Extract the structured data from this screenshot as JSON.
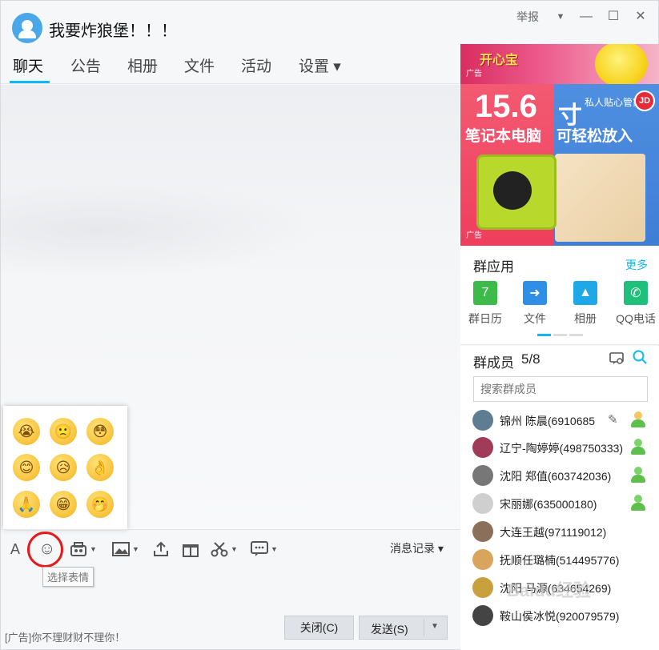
{
  "window": {
    "title": "我要炸狼堡！！！",
    "report_label": "举报",
    "dropdown_glyph": "▼",
    "minimize_glyph": "—",
    "maximize_glyph": "☐",
    "close_glyph": "✕"
  },
  "tabs": [
    {
      "label": "聊天",
      "active": true
    },
    {
      "label": "公告"
    },
    {
      "label": "相册"
    },
    {
      "label": "文件"
    },
    {
      "label": "活动"
    },
    {
      "label": "设置 ▾"
    }
  ],
  "emoji_panel": {
    "faces": [
      "😭",
      "🙁",
      "😳",
      "😊",
      "😥",
      "👌",
      "🙏",
      "😁",
      "🤭"
    ]
  },
  "toolbar": {
    "font_glyph": "A",
    "emoji_glyph": "☺",
    "tooltip": "选择表情",
    "history_label": "消息记录 ▾"
  },
  "footer": {
    "ad_text": "[广告]你不理财财不理你！",
    "close_label": "关闭(C)",
    "send_label": "发送(S)"
  },
  "ads": {
    "tag": "广告",
    "top_badge": "开心宝",
    "big_number": "15.6",
    "left_sub": "笔记本电脑",
    "cun": "寸",
    "cun_note": "私人贴心管家",
    "right_sub": "可轻松放入",
    "jd": "JD"
  },
  "apps": {
    "title": "群应用",
    "more": "更多",
    "items": [
      {
        "label": "群日历",
        "icon": "calendar-icon",
        "color": "#3dbb4a",
        "glyph": "7"
      },
      {
        "label": "文件",
        "icon": "folder-icon",
        "color": "#2f8ee6",
        "glyph": "➜"
      },
      {
        "label": "相册",
        "icon": "album-icon",
        "color": "#1fa8e8",
        "glyph": "▲"
      },
      {
        "label": "QQ电话",
        "icon": "phone-icon",
        "color": "#21c07a",
        "glyph": "✆"
      }
    ]
  },
  "members": {
    "title": "群成员",
    "count": "5/8",
    "search_placeholder": "搜索群成员",
    "list": [
      {
        "name": "锦州 陈晨(6910685",
        "avatar": "#5f7d92",
        "role": "owner",
        "edit": true
      },
      {
        "name": "辽宁-陶婷婷(498750333)",
        "avatar": "#a13b5a",
        "role": "member"
      },
      {
        "name": "沈阳 郑值(603742036)",
        "avatar": "#777777",
        "role": "member"
      },
      {
        "name": "宋丽娜(635000180)",
        "avatar": "#cfcfcf",
        "role": "member"
      },
      {
        "name": "大连王越(971119012)",
        "avatar": "#8a6f5b",
        "role": "none"
      },
      {
        "name": "抚顺任璐楠(514495776)",
        "avatar": "#d9a45c",
        "role": "none"
      },
      {
        "name": "沈阳 马源(634654269)",
        "avatar": "#c9a03e",
        "role": "none"
      },
      {
        "name": "鞍山侯冰悦(920079579)",
        "avatar": "#444444",
        "role": "none"
      }
    ]
  },
  "watermark": "Baidu经验"
}
